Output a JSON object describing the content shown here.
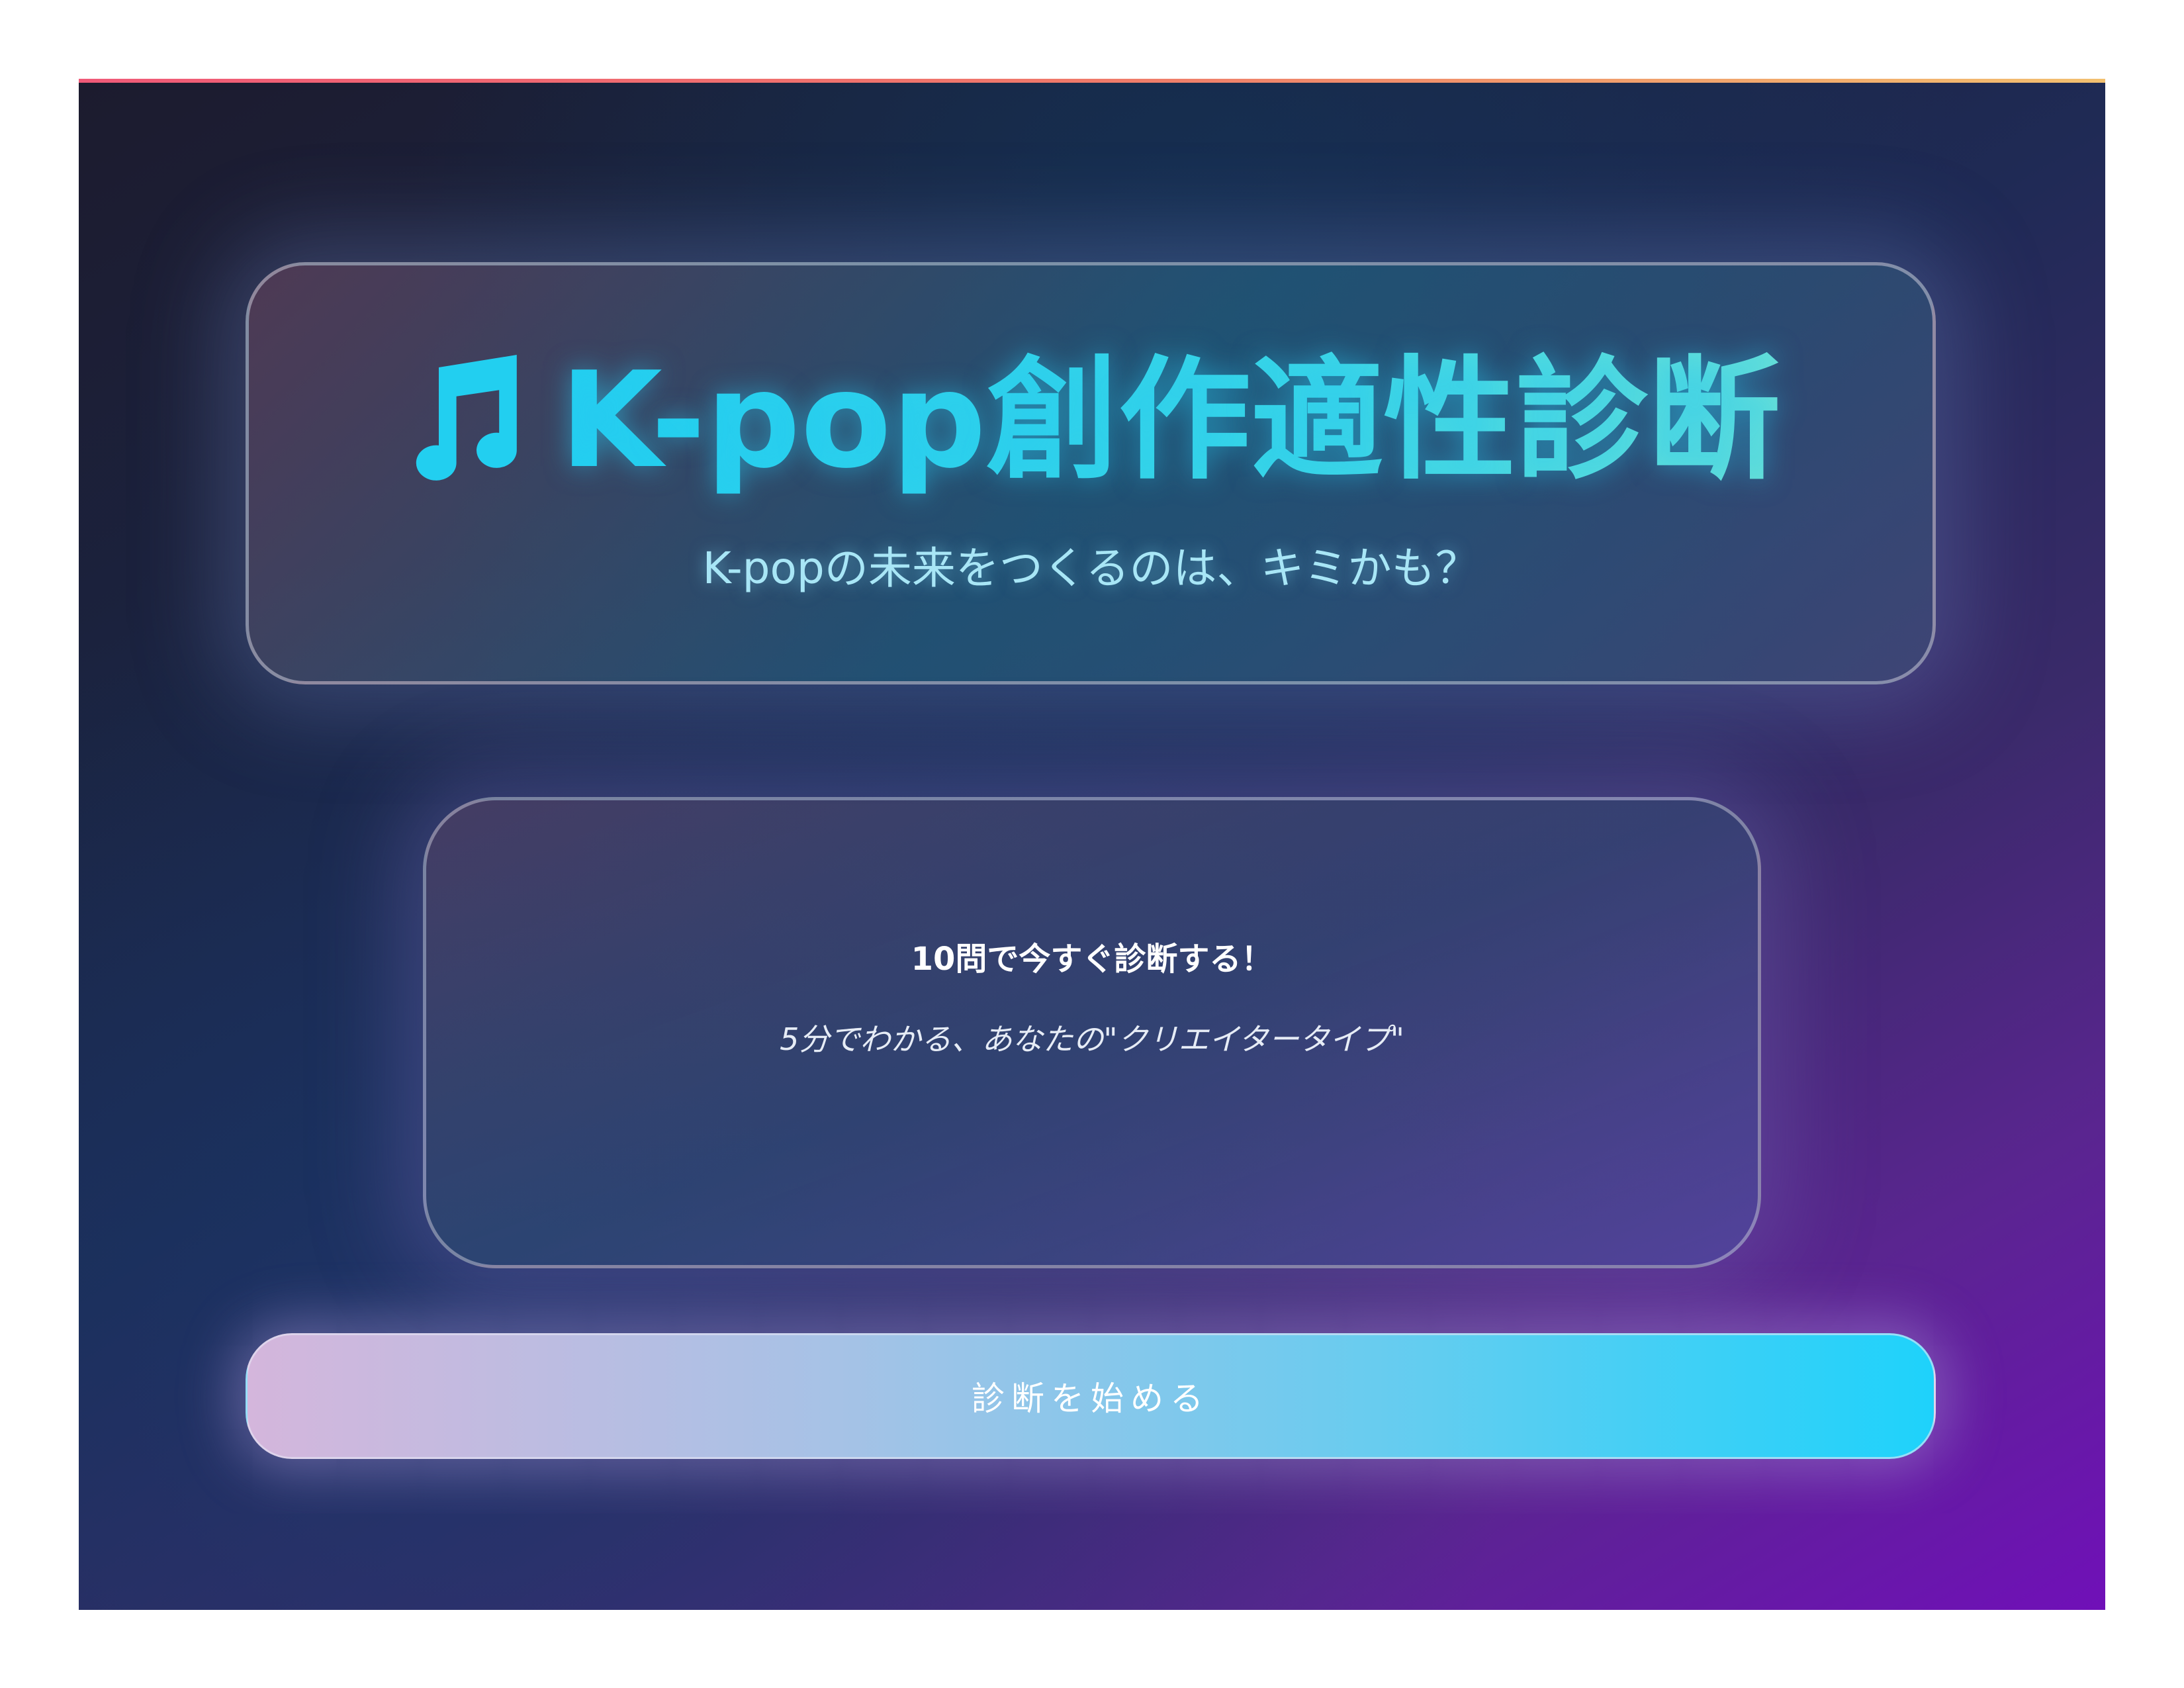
{
  "header": {
    "icon": "music-note-icon",
    "title": "K-pop創作適性診断",
    "subtitle": "K-popの未来をつくるのは、キミかも？"
  },
  "info": {
    "headline": "10問で今すぐ診断する！",
    "sub": "5分でわかる、あなたの\"クリエイタータイプ\""
  },
  "start_button": {
    "label": "診断を始める"
  },
  "colors": {
    "title_cyan": "#2fd4ee",
    "subtitle_cyan": "#a8e6f6",
    "button_start": "#d4b6dc",
    "button_end": "#1ed2fb",
    "topbar_start": "#f05a78",
    "topbar_end": "#f2c070",
    "background_dark": "#1c1b2e",
    "background_purple": "#7010b8"
  }
}
